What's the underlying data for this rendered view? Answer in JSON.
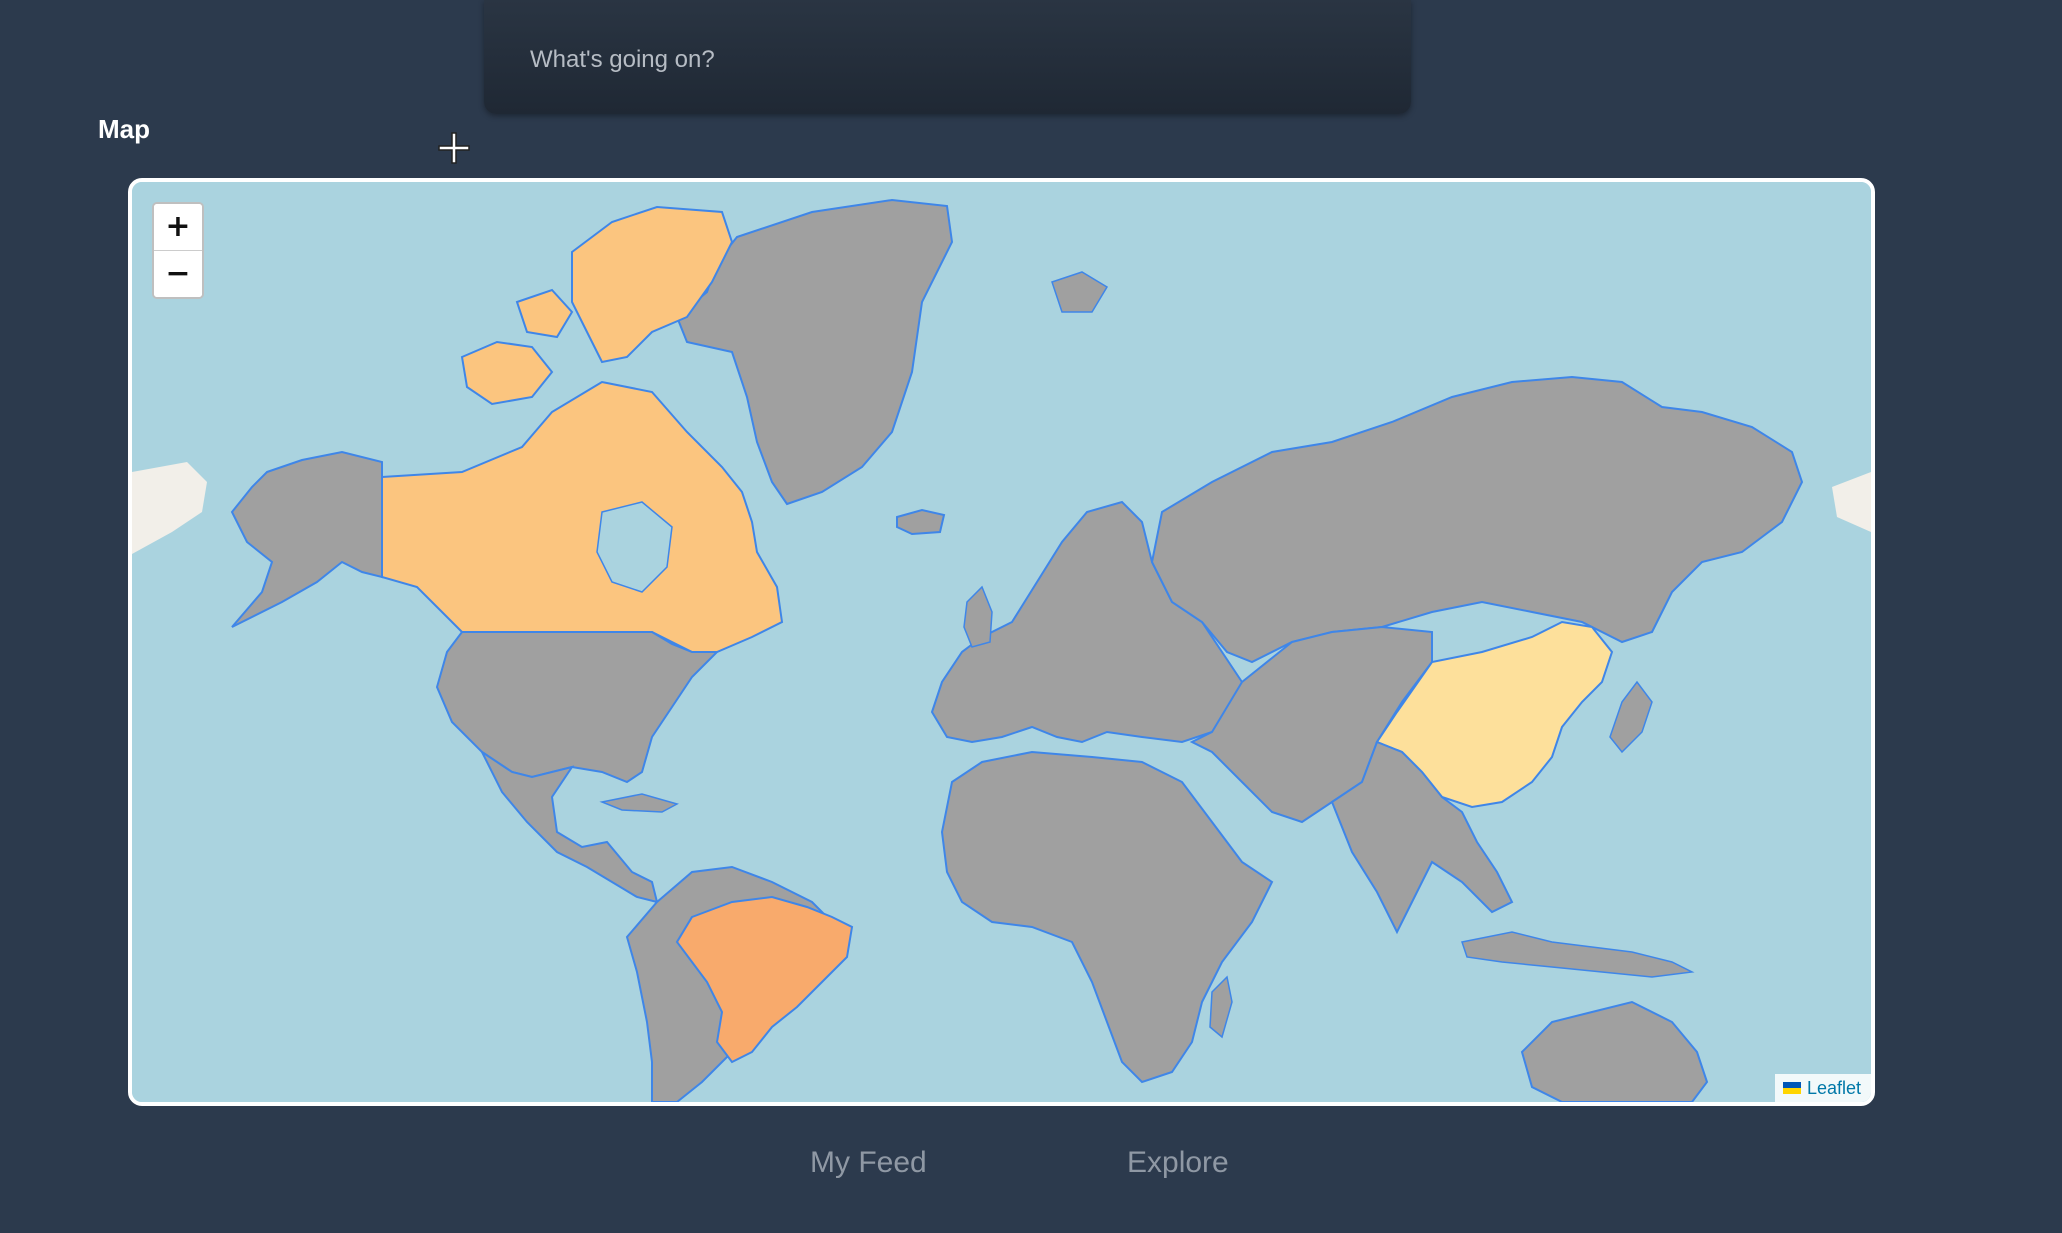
{
  "composer": {
    "placeholder": "What's going on?"
  },
  "section": {
    "title": "Map"
  },
  "map": {
    "zoom_in_label": "+",
    "zoom_out_label": "−",
    "attribution": "Leaflet",
    "colors": {
      "ocean": "#aad3df",
      "land_default": "#a0a0a0",
      "border": "#3f86e8",
      "canada": "#fbc57f",
      "brazil": "#f8aa6c",
      "china": "#fde09b",
      "offmap_land": "#f2efe9"
    },
    "highlighted_countries": [
      {
        "name": "Canada",
        "color": "#fbc57f"
      },
      {
        "name": "Brazil",
        "color": "#f8aa6c"
      },
      {
        "name": "China",
        "color": "#fde09b"
      }
    ]
  },
  "nav": {
    "feed_label": "My Feed",
    "explore_label": "Explore"
  }
}
